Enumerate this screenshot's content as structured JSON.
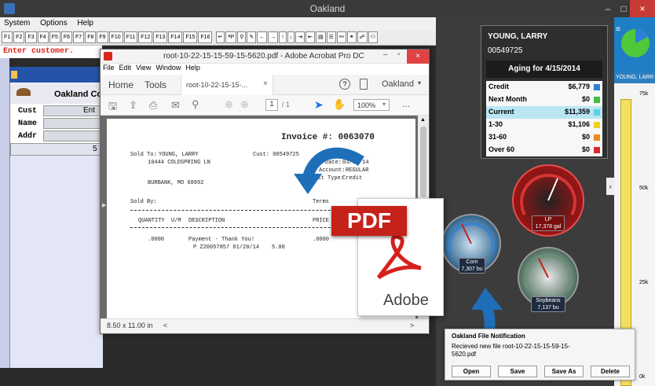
{
  "app": {
    "title": "Oakland",
    "minimize": "–",
    "maximize": "□",
    "close": "×"
  },
  "menubar": [
    "System",
    "Options",
    "Help"
  ],
  "toolbar": {
    "fkeys": [
      "F1",
      "F2",
      "F3",
      "F4",
      "F5",
      "F6",
      "F7",
      "F8",
      "F9",
      "F10",
      "F11",
      "F12",
      "F13",
      "F14",
      "F15",
      "F16"
    ]
  },
  "status_line": "Enter customer.",
  "form": {
    "company": "Oakland Co",
    "cust_label": "Cust",
    "cust_value": "Ent",
    "name_label": "Name",
    "addr_label": "Addr",
    "digit": "5"
  },
  "acrobat": {
    "title": "root-10-22-15-15-59-15-5620.pdf - Adobe Acrobat Pro DC",
    "menu": [
      "File",
      "Edit",
      "View",
      "Window",
      "Help"
    ],
    "tabs": {
      "home": "Home",
      "tools": "Tools",
      "doc": "root-10-22-15-15-...",
      "doc_close": "×",
      "help": "?",
      "user": "Oakland"
    },
    "toolbar": {
      "page_current": "1",
      "page_total": "/ 1",
      "zoom": "100%",
      "more": "..."
    },
    "status": {
      "size": "8.50 x 11.00 in"
    },
    "invoice": {
      "title": "Invoice #: 0063070",
      "sold_to_label": "Sold To:",
      "sold_to_name": "YOUNG, LARRY",
      "cust_label": "Cust: 00549725",
      "addr1": "10444 COLDSPRING LN",
      "addr2": "BURBANK, MO 68992",
      "date_label": "Date:",
      "date": "03/18/14",
      "account_label": "Account:",
      "account": "REGULAR",
      "disttype_label": "Dist Type:",
      "disttype": "Credit",
      "soldby_label": "Sold By:",
      "terms_label": "Terms",
      "col_qty": "QUANTITY",
      "col_um": "U/M",
      "col_desc": "DESCRIPTION",
      "col_price": "PRICE",
      "line_qty": ".0000",
      "line_desc1": "Payment - Thank You!",
      "line_desc2": "P Z20057857 01/20/14",
      "line_amt": "5.00",
      "line_price": ".0000"
    }
  },
  "pdf_icon": {
    "badge": "PDF",
    "brand": "Adobe"
  },
  "customer_card": {
    "name": "YOUNG, LARRY",
    "number": "00549725",
    "aging_title": "Aging for 4/15/2014",
    "rows": [
      {
        "label": "Credit",
        "value": "$6,779",
        "color": "#2f7fd6"
      },
      {
        "label": "Next Month",
        "value": "$0",
        "color": "#3fbf3a"
      },
      {
        "label": "Current",
        "value": "$11,359",
        "color": "#5fd0e8"
      },
      {
        "label": "1-30",
        "value": "$1,106",
        "color": "#f3d21b"
      },
      {
        "label": "31-60",
        "value": "$0",
        "color": "#f08a1a"
      },
      {
        "label": "Over 60",
        "value": "$0",
        "color": "#d62b2b"
      }
    ]
  },
  "sidebar": {
    "name": "YOUNG, LARR",
    "ticks": [
      "75k",
      "50k",
      "25k",
      "0k"
    ]
  },
  "gauges": [
    {
      "name": "Corn",
      "value": "7,307 bu",
      "level": 0.35
    },
    {
      "name": "LP",
      "value": "17,378 gal",
      "level": 0.5
    },
    {
      "name": "Soybeans",
      "value": "7,137 bu",
      "level": 0.4
    }
  ],
  "notification": {
    "title": "Oakland File Notification",
    "message": "Recieved new file root-10-22-15-15-59-15-5620.pdf",
    "buttons": [
      "Open",
      "Save",
      "Save As",
      "Delete"
    ]
  }
}
